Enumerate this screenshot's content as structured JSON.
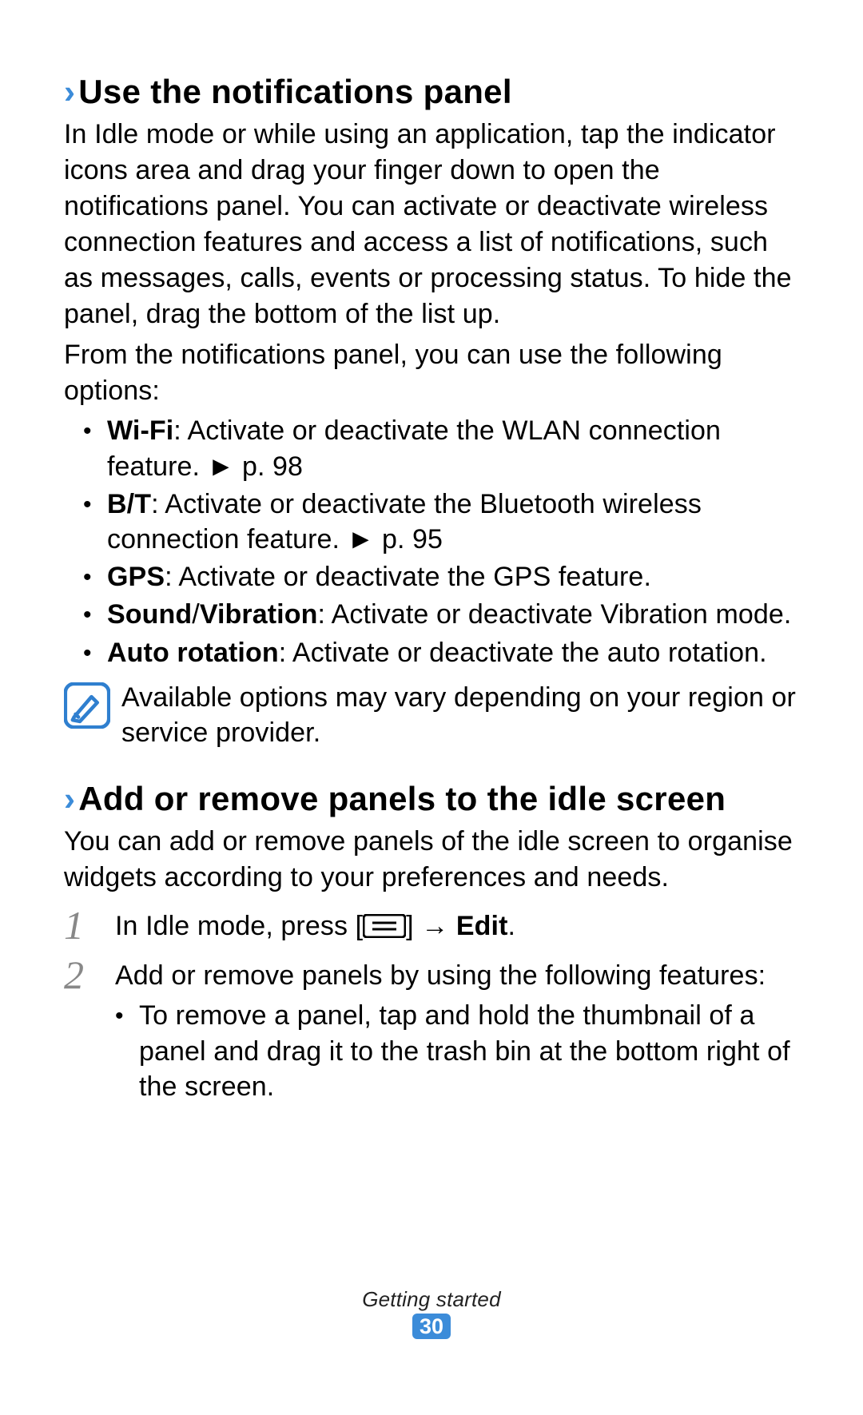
{
  "section1": {
    "heading": "Use the notifications panel",
    "para1": "In Idle mode or while using an application, tap the indicator icons area and drag your finger down to open the notifications panel. You can activate or deactivate wireless connection features and access a list of notifications, such as messages, calls, events or processing status. To hide the panel, drag the bottom of the list up.",
    "para2": "From the notifications panel, you can use the following options:",
    "bullets": [
      {
        "label": "Wi-Fi",
        "text": ": Activate or deactivate the WLAN connection feature. ► p. 98"
      },
      {
        "label": "B/T",
        "text": ": Activate or deactivate the Bluetooth wireless connection feature. ► p. 95"
      },
      {
        "label": "GPS",
        "text": ": Activate or deactivate the GPS feature."
      },
      {
        "label": "Sound",
        "label2": "Vibration",
        "text": ": Activate or deactivate Vibration mode."
      },
      {
        "label": "Auto rotation",
        "text": ": Activate or deactivate the auto rotation."
      }
    ],
    "note": "Available options may vary depending on your region or service provider."
  },
  "section2": {
    "heading": "Add or remove panels to the idle screen",
    "para1": "You can add or remove panels of the idle screen to organise widgets according to your preferences and needs.",
    "step1_prefix": "In Idle mode, press [",
    "step1_mid": "] → ",
    "step1_edit": "Edit",
    "step1_suffix": ".",
    "step2_intro": "Add or remove panels by using the following features:",
    "step2_bullets": [
      "To remove a panel, tap and hold the thumbnail of a panel and drag it to the trash bin at the bottom right of the screen."
    ]
  },
  "footer": {
    "section": "Getting started",
    "page": "30"
  }
}
